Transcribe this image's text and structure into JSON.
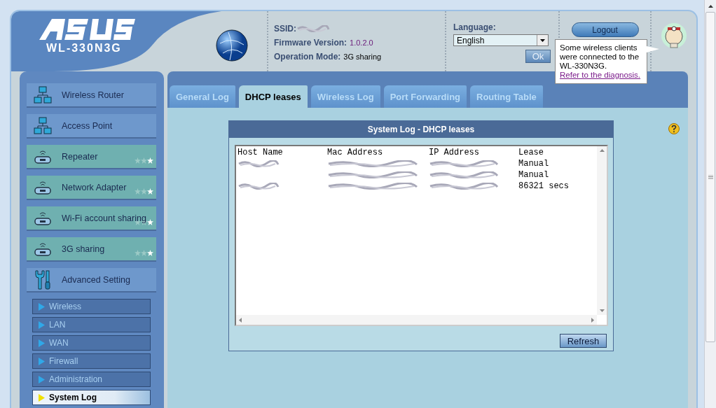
{
  "header": {
    "brand": "WL-330N3G",
    "ssid_label": "SSID:",
    "firmware_label": "Firmware Version:",
    "firmware_value": "1.0.2.0",
    "mode_label": "Operation Mode:",
    "mode_value": "3G sharing",
    "language_label": "Language:",
    "language_value": "English",
    "ok_button": "Ok",
    "logout_button": "Logout"
  },
  "tooltip": {
    "text": "Some wireless clients were connected to the WL-330N3G.",
    "link": "Refer to the diagnosis."
  },
  "sidebar": {
    "modes": [
      {
        "label": "Wireless Router",
        "kind": "router"
      },
      {
        "label": "Access Point",
        "kind": "router"
      },
      {
        "label": "Repeater",
        "kind": "adapter"
      },
      {
        "label": "Network Adapter",
        "kind": "adapter"
      },
      {
        "label": "Wi-Fi account sharing",
        "kind": "adapter"
      },
      {
        "label": "3G sharing",
        "kind": "adapter"
      },
      {
        "label": "Advanced Setting",
        "kind": "tools"
      }
    ],
    "submenu": [
      {
        "label": "Wireless",
        "selected": false
      },
      {
        "label": "LAN",
        "selected": false
      },
      {
        "label": "WAN",
        "selected": false
      },
      {
        "label": "Firewall",
        "selected": false
      },
      {
        "label": "Administration",
        "selected": false
      },
      {
        "label": "System Log",
        "selected": true
      }
    ]
  },
  "tabs": [
    {
      "label": "General Log",
      "selected": false
    },
    {
      "label": "DHCP leases",
      "selected": true
    },
    {
      "label": "Wireless Log",
      "selected": false
    },
    {
      "label": "Port Forwarding",
      "selected": false
    },
    {
      "label": "Routing Table",
      "selected": false
    }
  ],
  "log": {
    "title": "System Log - DHCP leases",
    "columns": [
      "Host Name",
      "Mac Address",
      "IP Address",
      "Lease"
    ],
    "rows": [
      {
        "host_redacted": true,
        "lease": "Manual"
      },
      {
        "host_redacted": false,
        "lease": "Manual"
      },
      {
        "host_redacted": true,
        "lease": "86321 secs"
      }
    ],
    "refresh_button": "Refresh"
  }
}
